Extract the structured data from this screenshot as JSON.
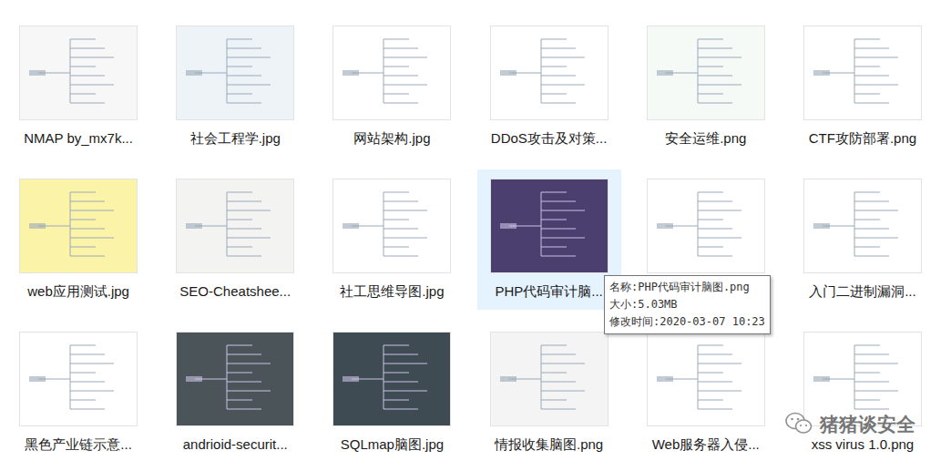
{
  "items": [
    {
      "label": "NMAP by_mx7k...",
      "color": "#f7f7f7",
      "hovered": false
    },
    {
      "label": "社会工程学.jpg",
      "color": "#eef3f8",
      "hovered": false
    },
    {
      "label": "网站架构.jpg",
      "color": "#ffffff",
      "hovered": false
    },
    {
      "label": "DDoS攻击及对策...",
      "color": "#ffffff",
      "hovered": false
    },
    {
      "label": "安全运维.png",
      "color": "#f6faf6",
      "hovered": false
    },
    {
      "label": "CTF攻防部署.png",
      "color": "#ffffff",
      "hovered": false
    },
    {
      "label": "web应用测试.jpg",
      "color": "#fbf3a8",
      "hovered": false
    },
    {
      "label": "SEO-Cheatshee...",
      "color": "#f3f4f1",
      "hovered": false
    },
    {
      "label": "社工思维导图.jpg",
      "color": "#ffffff",
      "hovered": false
    },
    {
      "label": "PHP代码审计脑...",
      "color": "#4a3f6e",
      "hovered": true
    },
    {
      "label": "",
      "color": "#ffffff",
      "hovered": false
    },
    {
      "label": "入门二进制漏洞...",
      "color": "#ffffff",
      "hovered": false
    },
    {
      "label": "黑色产业链示意...",
      "color": "#ffffff",
      "hovered": false
    },
    {
      "label": "andrioid-securit...",
      "color": "#4b5459",
      "hovered": false
    },
    {
      "label": "SQLmap脑图.jpg",
      "color": "#3f4b52",
      "hovered": false
    },
    {
      "label": "情报收集脑图.png",
      "color": "#f4f4f4",
      "hovered": false
    },
    {
      "label": "Web服务器入侵...",
      "color": "#ffffff",
      "hovered": false
    },
    {
      "label": "xss virus 1.0.png",
      "color": "#ffffff",
      "hovered": false
    }
  ],
  "tooltip": {
    "lines": [
      "名称:PHP代码审计脑图.png",
      "大小:5.03MB",
      "修改时间:2020-03-07 10:23"
    ]
  },
  "watermark": {
    "text": "猪猪谈安全"
  }
}
